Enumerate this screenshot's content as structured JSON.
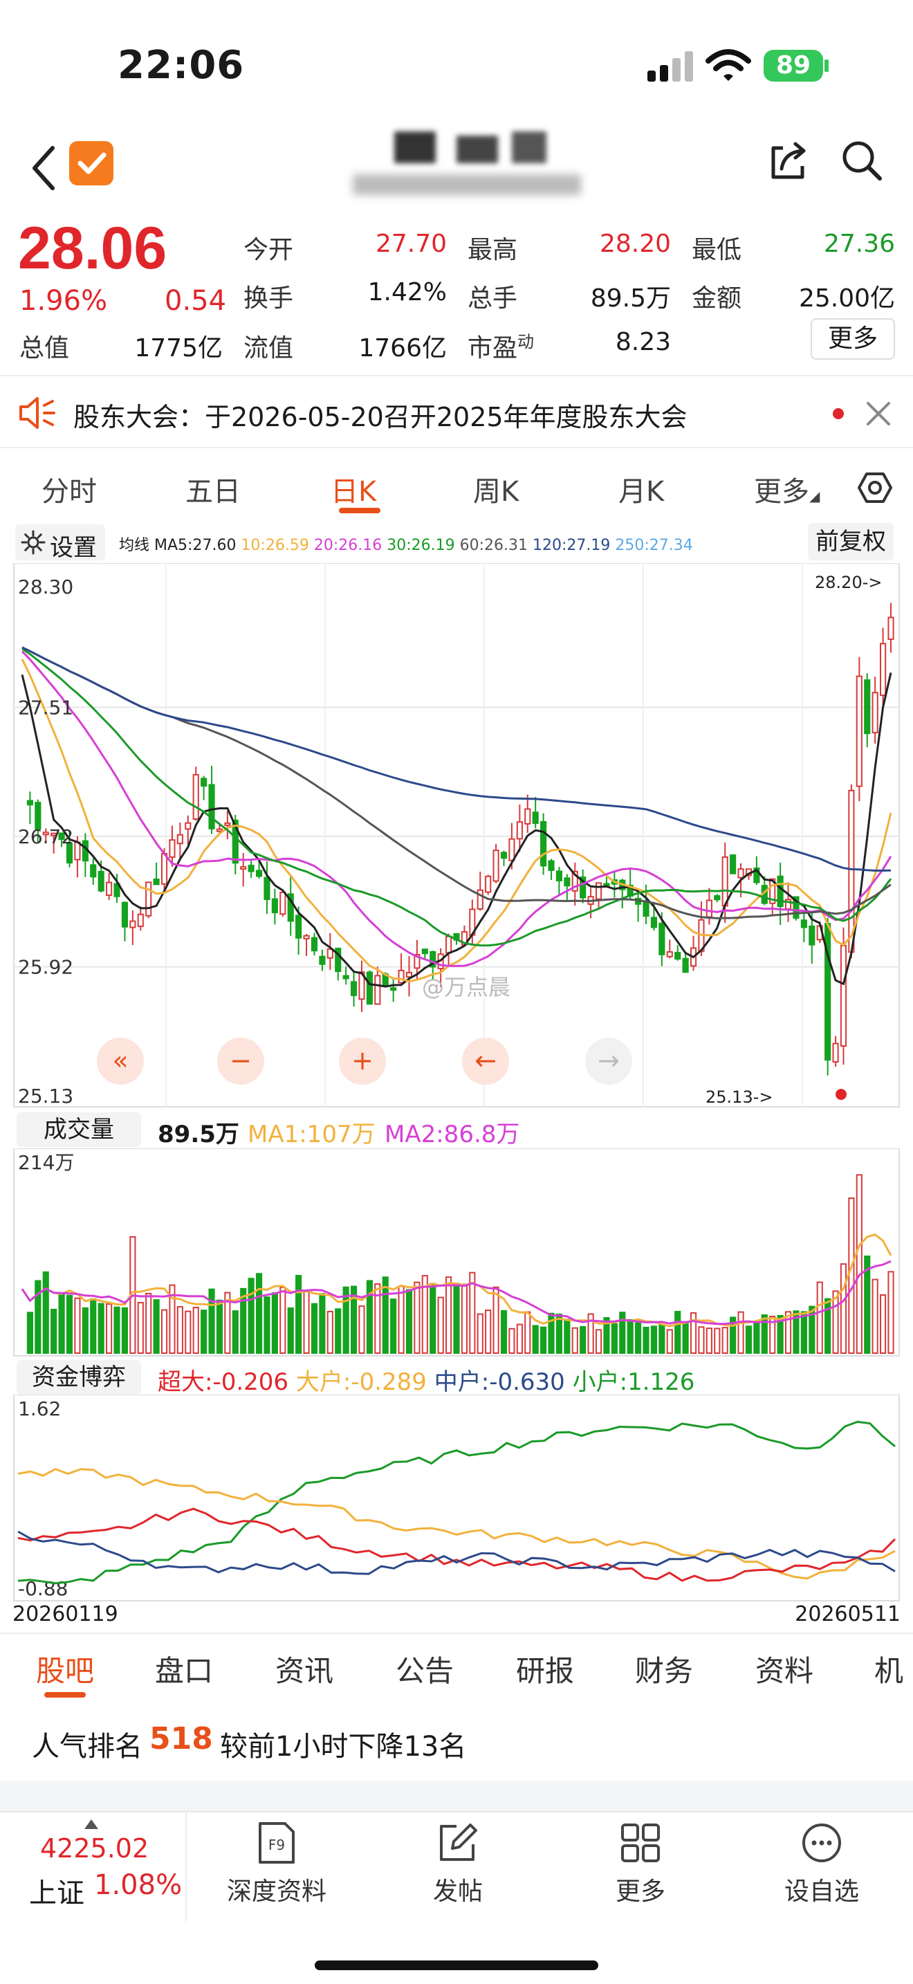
{
  "status_bar": {
    "time": "22:06",
    "battery": "89"
  },
  "stock": {
    "price": "28.06",
    "change_pct": "1.96%",
    "change": "0.54",
    "quotes": [
      {
        "label": "今开",
        "value": "27.70",
        "color": "red"
      },
      {
        "label": "最高",
        "value": "28.20",
        "color": "red"
      },
      {
        "label": "最低",
        "value": "27.36",
        "color": "green"
      },
      {
        "label": "换手",
        "value": "1.42%",
        "color": "black"
      },
      {
        "label": "总手",
        "value": "89.5万",
        "color": "black"
      },
      {
        "label": "金额",
        "value": "25.00亿",
        "color": "black"
      },
      {
        "label": "总值",
        "value": "1775亿",
        "color": "black"
      },
      {
        "label": "流值",
        "value": "1766亿",
        "color": "black"
      },
      {
        "label": "市盈",
        "sup": "动",
        "value": "8.23",
        "color": "black"
      }
    ],
    "more_button": "更多"
  },
  "notice": {
    "text": "股东大会：于2026-05-20召开2025年年度股东大会"
  },
  "period_tabs": [
    "分时",
    "五日",
    "日K",
    "周K",
    "月K",
    "更多"
  ],
  "active_tab": "日K",
  "kline": {
    "settings_label": "设置",
    "ma_prefix": "均线",
    "ma_items": [
      {
        "text": "MA5:27.60",
        "color": "#222222"
      },
      {
        "text": "10:26.59",
        "color": "#f2b13c"
      },
      {
        "text": "20:26.16",
        "color": "#d63fd6"
      },
      {
        "text": "30:26.19",
        "color": "#1a9a28"
      },
      {
        "text": "60:26.31",
        "color": "#555555"
      },
      {
        "text": "120:27.19",
        "color": "#2c4a8a"
      },
      {
        "text": "250:27.34",
        "color": "#5aa9e6"
      }
    ],
    "adjust_label": "前复权",
    "y_labels": [
      "28.30",
      "27.51",
      "26.72",
      "25.92",
      "25.13"
    ],
    "high_marker": "28.20->",
    "low_marker": "25.13->",
    "watermark": "@万点晨",
    "controls": [
      "«",
      "−",
      "+",
      "←",
      "→"
    ]
  },
  "volume": {
    "title": "成交量",
    "value": "89.5万",
    "ma1": "MA1:107万",
    "ma2": "MA2:86.8万",
    "max_label": "214万"
  },
  "fund_flow": {
    "title": "资金博弈",
    "items": [
      {
        "text": "超大:-0.206",
        "color": "#e0262b"
      },
      {
        "text": "大户:-0.289",
        "color": "#f2b13c"
      },
      {
        "text": "中户:-0.630",
        "color": "#2c4a8a"
      },
      {
        "text": "小户:1.126",
        "color": "#1a9a28"
      }
    ],
    "max_label": "1.62",
    "min_label": "-0.88",
    "start_date": "20260119",
    "end_date": "20260511"
  },
  "bottom_tabs": [
    "股吧",
    "盘口",
    "资讯",
    "公告",
    "研报",
    "财务",
    "资料",
    "机"
  ],
  "popularity": {
    "prefix": "人气排名",
    "rank": "518",
    "suffix": "较前1小时下降13名"
  },
  "index": {
    "value": "4225.02",
    "name": "上证",
    "pct": "1.08%"
  },
  "nav": [
    "深度资料",
    "发帖",
    "更多",
    "设自选"
  ],
  "colors": {
    "up": "#e0262b",
    "down": "#1a9a28",
    "accent": "#e8501a"
  }
}
